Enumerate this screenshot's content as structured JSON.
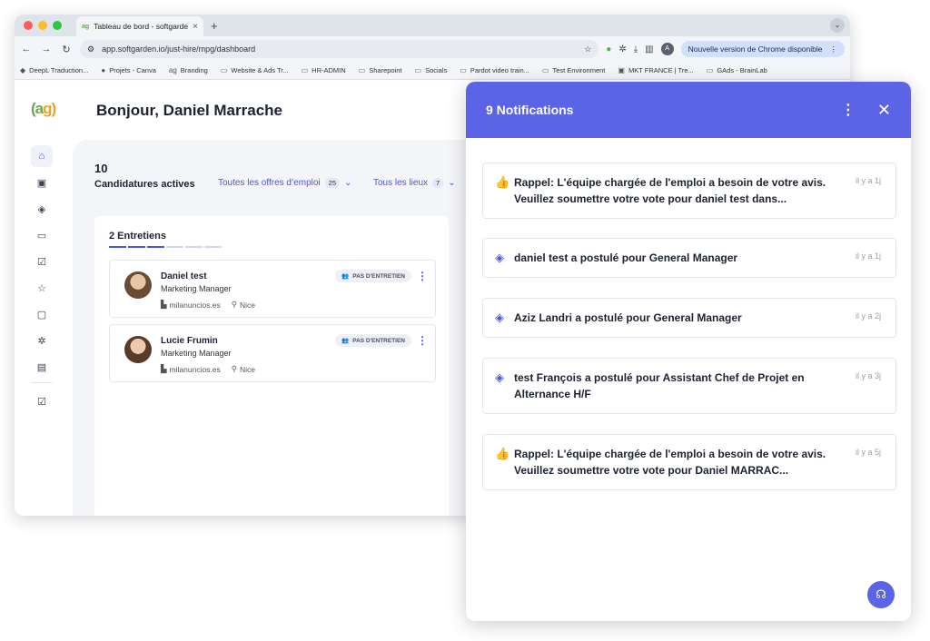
{
  "browser": {
    "tab_title": "Tableau de bord - softgarden",
    "tab_favicon": "ag",
    "tab_close": "×",
    "new_tab": "+",
    "url": "app.softgarden.io/just-hire/mpg/dashboard",
    "profile_initial": "A",
    "update_label": "Nouvelle version de Chrome disponible",
    "bookmarks": [
      {
        "label": "DeepL Traduction...",
        "icon": "deepl-icon"
      },
      {
        "label": "Projets - Canva",
        "icon": "canva-icon"
      },
      {
        "label": "Branding",
        "icon": "ag-logo-icon"
      },
      {
        "label": "Website & Ads Tr...",
        "icon": "folder-icon"
      },
      {
        "label": "HR-ADMIN",
        "icon": "folder-icon"
      },
      {
        "label": "Sharepoint",
        "icon": "folder-icon"
      },
      {
        "label": "Socials",
        "icon": "folder-icon"
      },
      {
        "label": "Pardot video train...",
        "icon": "folder-icon"
      },
      {
        "label": "Test Environment",
        "icon": "folder-icon"
      },
      {
        "label": "MKT FRANCE | Tre...",
        "icon": "trello-icon"
      },
      {
        "label": "GAds - BrainLab",
        "icon": "folder-icon"
      }
    ]
  },
  "app": {
    "logo": {
      "part1": "(a",
      "part2": "g)"
    },
    "greeting": "Bonjour, Daniel Marrache",
    "active_count": "10",
    "active_label": "Candidatures actives",
    "filters": [
      {
        "label": "Toutes les offres d’emploi",
        "count": "25"
      },
      {
        "label": "Tous les lieux",
        "count": "7"
      }
    ],
    "interviews": {
      "title": "2 Entretiens",
      "candidates": [
        {
          "name": "Daniel test",
          "role": "Marketing Manager",
          "company": "milanuncios.es",
          "city": "Nice",
          "status": "PAS D'ENTRETIEN"
        },
        {
          "name": "Lucie Frumin",
          "role": "Marketing Manager",
          "company": "milanuncios.es",
          "city": "Nice",
          "status": "PAS D'ENTRETIEN"
        }
      ]
    }
  },
  "notifications": {
    "title": "9 Notifications",
    "items": [
      {
        "icon": "thumbs-up-icon",
        "text": "Rappel: L'équipe chargée de l'emploi a besoin de votre avis. Veuillez soumettre votre vote pour daniel test dans...",
        "time": "il y a 1j"
      },
      {
        "icon": "layers-icon",
        "text": "daniel test a postulé pour General Manager",
        "time": "il y a 1j"
      },
      {
        "icon": "layers-icon",
        "text": "Aziz Landri a postulé pour General Manager",
        "time": "il y a 2j"
      },
      {
        "icon": "layers-icon",
        "text": "test François a postulé pour Assistant Chef de Projet en Alternance H/F",
        "time": "il y a 3j"
      },
      {
        "icon": "thumbs-up-icon",
        "text": "Rappel: L'équipe chargée de l'emploi a besoin de votre avis. Veuillez soumettre votre vote pour Daniel MARRAC...",
        "time": "il y a 5j"
      }
    ]
  },
  "colors": {
    "accent": "#5b63e6",
    "link": "#4a56e0"
  }
}
